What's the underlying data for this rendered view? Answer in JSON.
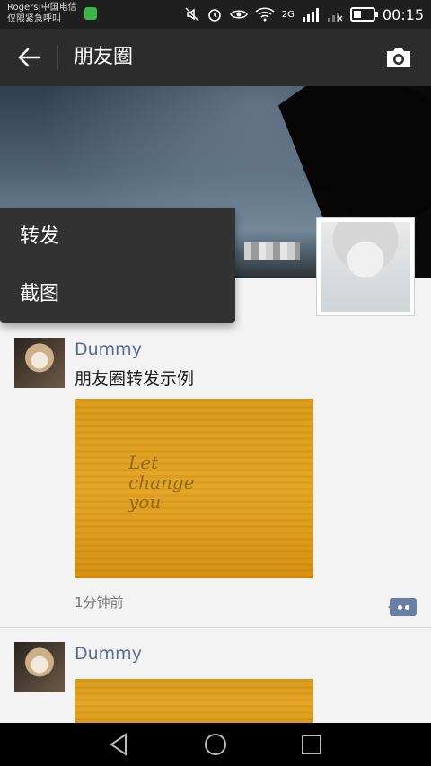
{
  "status_bar": {
    "carrier_line1": "Rogers|中国电信",
    "carrier_line2": "仅限紧急呼叫",
    "network": "2G",
    "battery_level": 0.4,
    "time": "00:15"
  },
  "title_bar": {
    "title": "朋友圈"
  },
  "popup_menu": {
    "items": [
      {
        "label": "转发"
      },
      {
        "label": "截图"
      }
    ]
  },
  "feed": {
    "posts": [
      {
        "name": "Dummy",
        "text": "朋友圈转发示例",
        "image_text": "Let\nchange\nyou",
        "time": "1分钟前"
      },
      {
        "name": "Dummy"
      }
    ]
  },
  "colors": {
    "accent_name": "#576b95",
    "popup_bg": "#323232",
    "titlebar_bg": "#2c2c2c",
    "image_yellow": "#e3a526"
  }
}
